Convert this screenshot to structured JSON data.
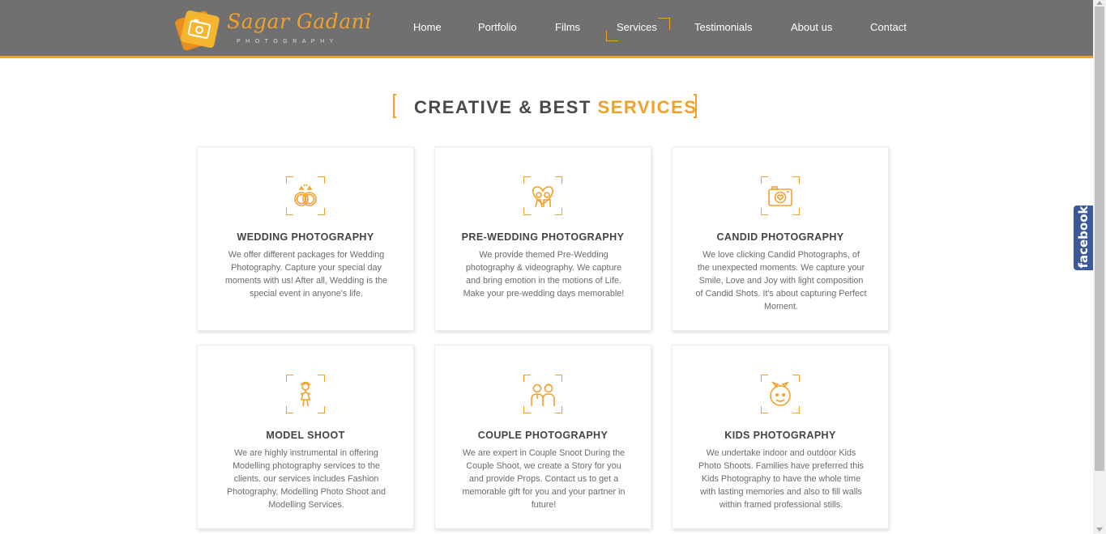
{
  "brand": {
    "name": "Sagar Gadani",
    "tagline": "PHOTOGRAPHY",
    "logo_icon": "camera-icon",
    "accent_color": "#f3a02a",
    "header_color": "#707070"
  },
  "nav": {
    "items": [
      {
        "label": "Home"
      },
      {
        "label": "Portfolio"
      },
      {
        "label": "Films"
      },
      {
        "label": "Services",
        "active": true
      },
      {
        "label": "Testimonials"
      },
      {
        "label": "About us"
      },
      {
        "label": "Contact"
      }
    ]
  },
  "section": {
    "title_main": "CREATIVE & BEST",
    "title_accent": "SERVICES"
  },
  "services": [
    {
      "icon": "wedding-rings-icon",
      "title": "WEDDING PHOTOGRAPHY",
      "desc_lines": [
        "We offer different packages for Wedding",
        "Photography. Capture your special day",
        "moments with us! After all, Wedding is the",
        "special event in anyone's life."
      ]
    },
    {
      "icon": "couple-heart-icon",
      "title": "PRE-WEDDING PHOTOGRAPHY",
      "desc_lines": [
        "We provide themed Pre-Wedding",
        "photography & videography. We capture",
        "and bring emotion in the motions of Life.",
        "Make your pre-wedding days memorable!"
      ]
    },
    {
      "icon": "camera-heart-icon",
      "title": "CANDID PHOTOGRAPHY",
      "desc_lines": [
        "We love clicking Candid Photographs, of",
        "the unexpected moments. We capture your",
        "Smile, Love and Joy with light composition",
        "of Candid Shots. It's about capturing Perfect",
        "Moment."
      ]
    },
    {
      "icon": "model-icon",
      "title": "MODEL SHOOT",
      "desc_lines": [
        "We are highly instrumental in offering",
        "Modelling photography services to the",
        "clients. our services includes Fashion",
        "Photography, Modelling Photo Shoot and",
        "Modelling Services."
      ]
    },
    {
      "icon": "couple-icon",
      "title": "COUPLE PHOTOGRAPHY",
      "desc_lines": [
        "We are expert in Couple Snoot During the",
        "Couple Shoot, we create a Story for you",
        "and provide Props. Contact us to get a",
        "memorable gift for you and your partner in",
        "future!"
      ]
    },
    {
      "icon": "kid-face-icon",
      "title": "KIDS PHOTOGRAPHY",
      "desc_lines": [
        "We undertake indoor and outdoor Kids",
        "Photo Shoots. Families have preferred this",
        "Kids Photography to have the whole time",
        "with lasting memories and also to fill walls",
        "within framed professional stills."
      ]
    }
  ],
  "social": {
    "facebook_label": "facebook",
    "facebook_color": "#3b5998"
  }
}
